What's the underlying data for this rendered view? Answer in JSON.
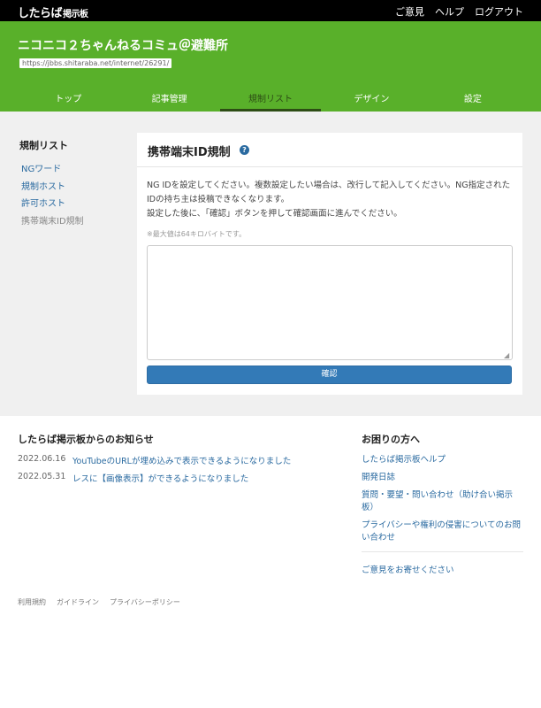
{
  "topbar": {
    "logo_main": "したらば",
    "logo_sub": "掲示板",
    "links": [
      "ご意見",
      "ヘルプ",
      "ログアウト"
    ]
  },
  "header": {
    "board_title": "ニコニコ２ちゃんねるコミュ＠避難所",
    "board_url": "https://jbbs.shitaraba.net/internet/26291/",
    "tabs": [
      "トップ",
      "記事管理",
      "規制リスト",
      "デザイン",
      "設定"
    ],
    "active_tab": "規制リスト"
  },
  "sidebar": {
    "title": "規制リスト",
    "items": [
      "NGワード",
      "規制ホスト",
      "許可ホスト",
      "携帯端末ID規制"
    ]
  },
  "panel": {
    "title": "携帯端末ID規制",
    "help_icon": "?",
    "desc_line1": "NG IDを設定してください。複数設定したい場合は、改行して記入してください。NG指定されたIDの持ち主は投稿できなくなります。",
    "desc_line2": "設定した後に、「確認」ボタンを押して確認画面に進んでください。",
    "note": "※最大値は64キロバイトです。",
    "textarea_value": "",
    "confirm_label": "確認"
  },
  "news": {
    "title": "したらば掲示板からのお知らせ",
    "items": [
      {
        "date": "2022.06.16",
        "text": "YouTubeのURLが埋め込みで表示できるようになりました"
      },
      {
        "date": "2022.05.31",
        "text": "レスに【画像表示】ができるようになりました"
      }
    ]
  },
  "help": {
    "title": "お困りの方へ",
    "links": [
      "したらば掲示板ヘルプ",
      "開発日誌",
      "質問・要望・問い合わせ（助け合い掲示板）",
      "プライバシーや権利の侵害についてのお問い合わせ"
    ],
    "feedback": "ご意見をお寄せください"
  },
  "footer": {
    "links": [
      "利用規約",
      "ガイドライン",
      "プライバシーポリシー"
    ]
  },
  "colors": {
    "header_green": "#59b02a",
    "link_blue": "#2a6aa0",
    "button_blue": "#337ab7"
  }
}
